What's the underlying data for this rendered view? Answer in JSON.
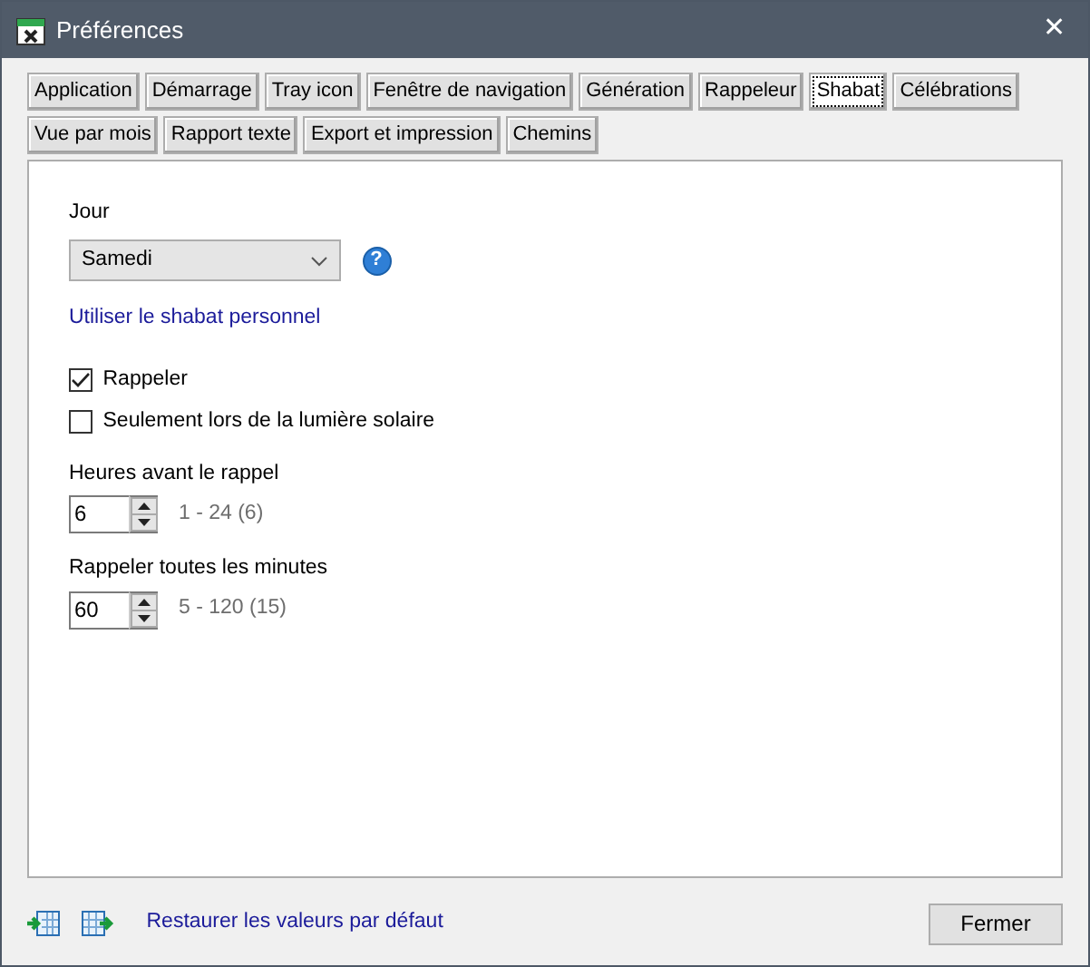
{
  "window": {
    "title": "Préférences",
    "close": "✕"
  },
  "tabs": [
    {
      "label": "Application",
      "selected": false
    },
    {
      "label": "Démarrage",
      "selected": false
    },
    {
      "label": "Tray icon",
      "selected": false
    },
    {
      "label": "Fenêtre de navigation",
      "selected": false
    },
    {
      "label": "Génération",
      "selected": false
    },
    {
      "label": "Rappeleur",
      "selected": false
    },
    {
      "label": "Shabat",
      "selected": true
    },
    {
      "label": "Célébrations",
      "selected": false
    },
    {
      "label": "Vue par mois",
      "selected": false
    },
    {
      "label": "Rapport texte",
      "selected": false
    },
    {
      "label": "Export et impression",
      "selected": false
    },
    {
      "label": "Chemins",
      "selected": false
    }
  ],
  "day": {
    "label": "Jour",
    "value": "Samedi",
    "help": "?"
  },
  "custom_link": "Utiliser le shabat personnel",
  "checkboxes": [
    {
      "label": "Rappeler",
      "checked": true
    },
    {
      "label": "Seulement lors de la lumière solaire",
      "checked": false
    }
  ],
  "spinners": [
    {
      "label": "Heures avant le rappel",
      "value": "6",
      "range": "1 - 24 (6)"
    },
    {
      "label": "Rappeler toutes les minutes",
      "value": "60",
      "range": "5 - 120 (15)"
    }
  ],
  "footer": {
    "reset_link": "Restaurer les valeurs par défaut",
    "close_button": "Fermer"
  }
}
